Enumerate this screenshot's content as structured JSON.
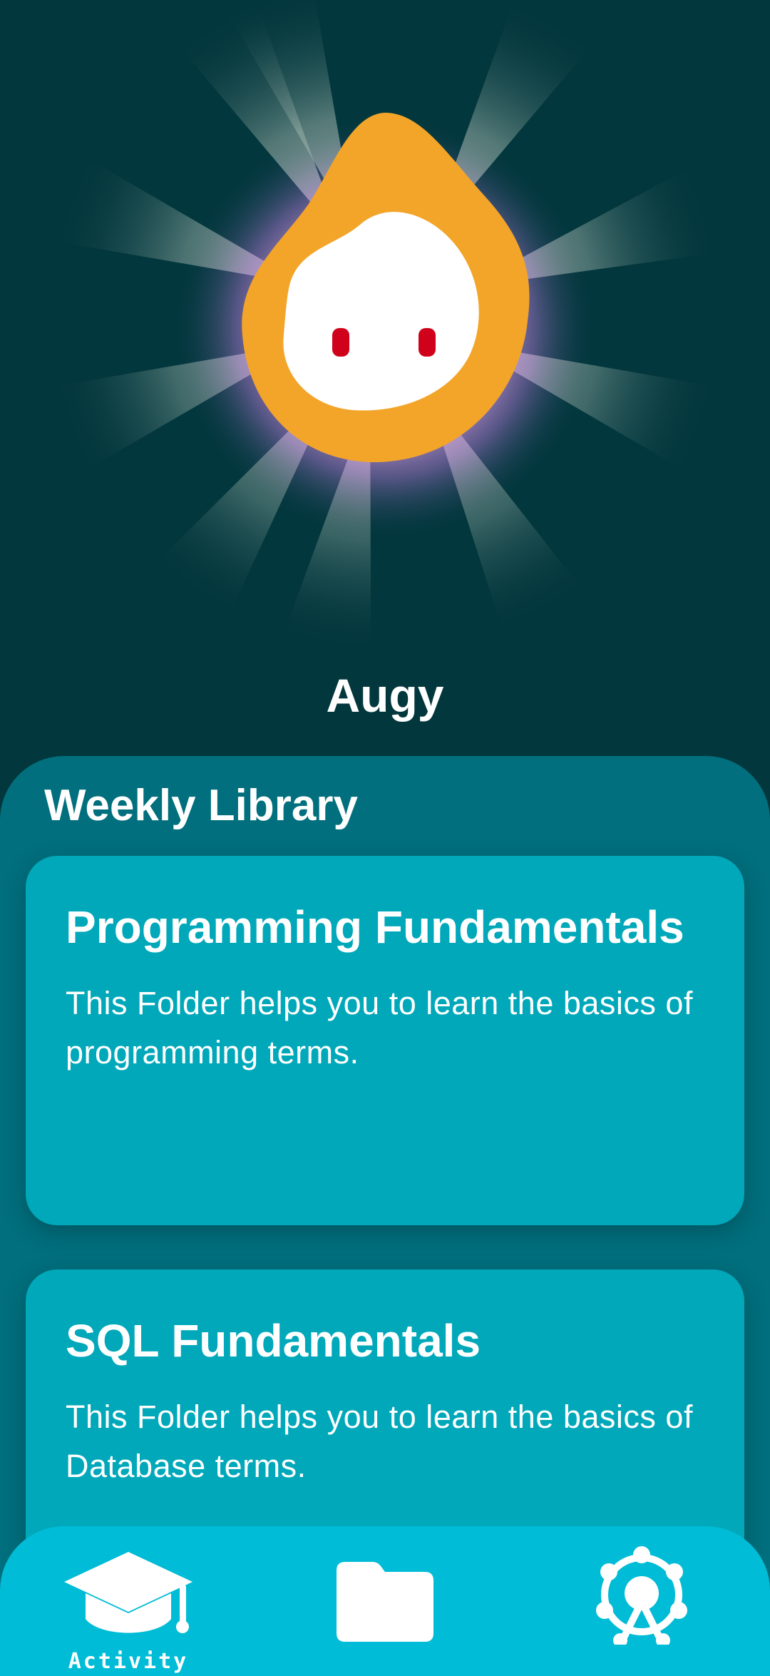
{
  "character": {
    "name": "Augy"
  },
  "library": {
    "title": "Weekly Library",
    "folders": [
      {
        "title": "Programming Fundamentals",
        "description": "This Folder helps you to learn the basics of programming terms."
      },
      {
        "title": "SQL Fundamentals",
        "description": "This Folder helps you to learn the basics of Database terms."
      }
    ]
  },
  "nav": {
    "items": [
      {
        "label": "Activity",
        "icon": "graduation-cap-icon",
        "active": true
      },
      {
        "label": "",
        "icon": "folder-icon",
        "active": false
      },
      {
        "label": "",
        "icon": "ferris-wheel-icon",
        "active": false
      }
    ]
  },
  "colors": {
    "background": "#02373d",
    "panel": "#016f7d",
    "card": "#00a8ba",
    "nav": "#00bcd6",
    "mascot_body": "#f3a52a",
    "mascot_face": "#ffffff",
    "mascot_eyes": "#d0021b"
  }
}
